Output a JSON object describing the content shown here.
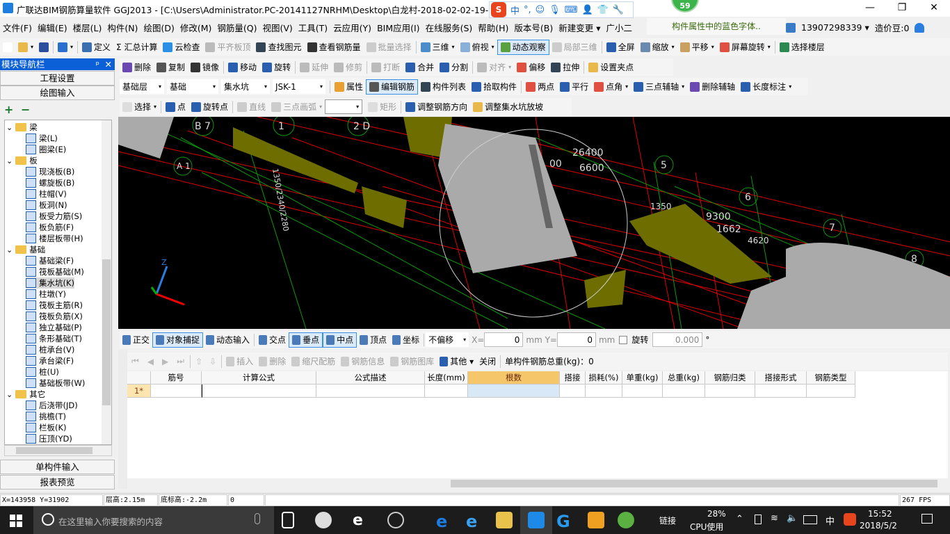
{
  "titlebar": {
    "title": "广联达BIM钢筋算量软件 GGJ2013 - [C:\\Users\\Administrator.PC-20141127NRHM\\Desktop\\白龙村-2018-02-02-19-24-35",
    "minimize": "—",
    "restore": "❐",
    "close": "✕"
  },
  "ime": {
    "logo": "S",
    "items": [
      "中",
      "°,",
      "☺",
      "🎙",
      "⌨",
      "👤",
      "👕",
      "🔧"
    ]
  },
  "badge": "59",
  "menu": [
    "文件(F)",
    "编辑(E)",
    "楼层(L)",
    "构件(N)",
    "绘图(D)",
    "修改(M)",
    "钢筋量(Q)",
    "视图(V)",
    "工具(T)",
    "云应用(Y)",
    "BIM应用(I)",
    "在线服务(S)",
    "帮助(H)",
    "版本号(B)",
    "新建变更 ▾",
    "广小二"
  ],
  "tip": "构件属性中的蓝色字体..",
  "account": {
    "phone": "13907298339 ▾",
    "beans": "造价豆:0"
  },
  "toolbar1": [
    {
      "l": "",
      "c": "#fff",
      "n": "new-file"
    },
    {
      "l": "",
      "c": "#e8b84a",
      "n": "open-folder",
      "dd": 1
    },
    {
      "l": "",
      "c": "#2b4f9e",
      "n": "save"
    },
    {
      "sep": 1
    },
    {
      "l": "",
      "c": "#2a6fd0",
      "n": "undo",
      "dd": 1
    },
    {
      "sep": 1
    },
    {
      "l": "定义",
      "c": "#3a6fb0",
      "n": "define"
    },
    {
      "l": "Σ 汇总计算",
      "n": "summary-calc"
    },
    {
      "l": "云检查",
      "c": "#2b8fe6",
      "n": "cloud-check"
    },
    {
      "l": "平齐板顶",
      "c": "#bbb",
      "n": "align-slab-top",
      "dis": 1
    },
    {
      "l": "查找图元",
      "c": "#345",
      "n": "find-element"
    },
    {
      "l": "查看钢筋量",
      "c": "#333",
      "n": "view-rebar"
    },
    {
      "l": "批量选择",
      "c": "#ccc",
      "n": "batch-select",
      "dis": 1
    },
    {
      "sep": 1
    },
    {
      "l": "三维",
      "c": "#4a8ccc",
      "n": "3d",
      "dd": 1
    },
    {
      "l": "俯视",
      "c": "#8ab0d8",
      "n": "top-view",
      "dd": 1
    },
    {
      "l": "动态观察",
      "c": "#5aa040",
      "n": "orbit",
      "act": 1
    },
    {
      "l": "局部三维",
      "c": "#ccc",
      "n": "local-3d",
      "dis": 1
    },
    {
      "sep": 1
    },
    {
      "l": "全屏",
      "c": "#2a5fb0",
      "n": "fullscreen"
    },
    {
      "l": "缩放",
      "c": "#6a8ab0",
      "n": "zoom",
      "dd": 1
    },
    {
      "l": "平移",
      "c": "#c8a060",
      "n": "pan",
      "dd": 1
    },
    {
      "l": "屏幕旋转",
      "c": "#e05040",
      "n": "screen-rotate",
      "dd": 1
    },
    {
      "sep": 1
    },
    {
      "l": "选择楼层",
      "c": "#2a8a50",
      "n": "select-floor"
    }
  ],
  "toolbar2": [
    {
      "l": "删除",
      "c": "#6a4ab0",
      "n": "delete"
    },
    {
      "l": "复制",
      "c": "#555",
      "n": "copy"
    },
    {
      "l": "镜像",
      "c": "#333",
      "n": "mirror"
    },
    {
      "sep": 1
    },
    {
      "l": "移动",
      "c": "#2a5fb0",
      "n": "move"
    },
    {
      "l": "旋转",
      "c": "#2a5fb0",
      "n": "rotate"
    },
    {
      "sep": 1
    },
    {
      "l": "延伸",
      "c": "#bbb",
      "n": "extend",
      "dis": 1
    },
    {
      "l": "修剪",
      "c": "#bbb",
      "n": "trim",
      "dis": 1
    },
    {
      "sep": 1
    },
    {
      "l": "打断",
      "c": "#bbb",
      "n": "break",
      "dis": 1
    },
    {
      "l": "合并",
      "c": "#2a5fb0",
      "n": "merge"
    },
    {
      "l": "分割",
      "c": "#2a5fb0",
      "n": "split"
    },
    {
      "sep": 1
    },
    {
      "l": "对齐",
      "c": "#bbb",
      "n": "align",
      "dis": 1,
      "dd": 1
    },
    {
      "l": "偏移",
      "c": "#e05040",
      "n": "offset"
    },
    {
      "l": "拉伸",
      "c": "#345",
      "n": "stretch"
    },
    {
      "sep": 1
    },
    {
      "l": "设置夹点",
      "c": "#e8b84a",
      "n": "set-grip"
    }
  ],
  "selectors": [
    "基础层",
    "基础",
    "集水坑",
    "JSK-1"
  ],
  "toolbar3": [
    {
      "l": "属性",
      "c": "#e8a030",
      "n": "properties"
    },
    {
      "l": "编辑钢筋",
      "c": "#555",
      "n": "edit-rebar",
      "act": 1
    },
    {
      "l": "构件列表",
      "c": "#345",
      "n": "component-list"
    },
    {
      "l": "拾取构件",
      "c": "#2a5fb0",
      "n": "pick-component"
    },
    {
      "sep": 1
    },
    {
      "l": "两点",
      "c": "#e05040",
      "n": "two-point"
    },
    {
      "l": "平行",
      "c": "#2a5fb0",
      "n": "parallel"
    },
    {
      "l": "点角",
      "c": "#e05040",
      "n": "point-angle",
      "dd": 1
    },
    {
      "l": "三点辅轴",
      "c": "#2a5fb0",
      "n": "three-point-axis",
      "dd": 1
    },
    {
      "l": "删除辅轴",
      "c": "#6a4ab0",
      "n": "delete-axis"
    },
    {
      "l": "长度标注",
      "c": "#2a5fb0",
      "n": "length-dim",
      "dd": 1
    }
  ],
  "toolbar4": [
    {
      "l": "选择",
      "c": "#ddd",
      "n": "select",
      "dd": 1
    },
    {
      "sep": 1
    },
    {
      "l": "点",
      "c": "#2a5fb0",
      "n": "point"
    },
    {
      "l": "旋转点",
      "c": "#2a5fb0",
      "n": "rotate-point"
    },
    {
      "sep": 1
    },
    {
      "l": "直线",
      "c": "#ccc",
      "n": "line",
      "dis": 1
    },
    {
      "l": "三点画弧",
      "c": "#ccc",
      "n": "three-point-arc",
      "dis": 1,
      "dd": 1
    },
    {
      "combo": 1
    },
    {
      "l": "矩形",
      "c": "#ddd",
      "n": "rectangle",
      "dis": 1
    },
    {
      "sep": 1
    },
    {
      "l": "调整钢筋方向",
      "c": "#2a5fb0",
      "n": "adjust-rebar-dir"
    },
    {
      "l": "调整集水坑放坡",
      "c": "#e8b84a",
      "n": "adjust-pit-slope"
    }
  ],
  "nav": {
    "title": "模块导航栏",
    "pin": "ᵖ",
    "close": "✕",
    "project_settings": "工程设置",
    "draw_input": "绘图输入",
    "single_input": "单构件输入",
    "report": "报表预览",
    "expand": "+",
    "collapse": "−"
  },
  "tree": [
    {
      "f": 1,
      "l": "梁"
    },
    {
      "l": "梁(L)"
    },
    {
      "l": "圈梁(E)"
    },
    {
      "f": 1,
      "l": "板"
    },
    {
      "l": "现浇板(B)"
    },
    {
      "l": "螺旋板(B)"
    },
    {
      "l": "柱帽(V)"
    },
    {
      "l": "板洞(N)"
    },
    {
      "l": "板受力筋(S)"
    },
    {
      "l": "板负筋(F)"
    },
    {
      "l": "楼层板带(H)"
    },
    {
      "f": 1,
      "l": "基础"
    },
    {
      "l": "基础梁(F)"
    },
    {
      "l": "筏板基础(M)"
    },
    {
      "l": "集水坑(K)",
      "sel": 1
    },
    {
      "l": "柱墩(Y)"
    },
    {
      "l": "筏板主筋(R)"
    },
    {
      "l": "筏板负筋(X)"
    },
    {
      "l": "独立基础(P)"
    },
    {
      "l": "条形基础(T)"
    },
    {
      "l": "桩承台(V)"
    },
    {
      "l": "承台梁(F)"
    },
    {
      "l": "桩(U)"
    },
    {
      "l": "基础板带(W)"
    },
    {
      "f": 1,
      "l": "其它"
    },
    {
      "l": "后浇带(JD)"
    },
    {
      "l": "挑檐(T)"
    },
    {
      "l": "栏板(K)"
    },
    {
      "l": "压顶(YD)"
    }
  ],
  "viewport": {
    "labels": [
      "B 7",
      "1",
      "2 D",
      "A 1",
      "26400",
      "6600",
      "5",
      "6",
      "7",
      "8",
      "9300",
      "1662",
      "1350",
      "4620",
      "00",
      "1350/2340/2280"
    ],
    "axis": "Z",
    "bg": "#000000"
  },
  "snapbar": {
    "items": [
      {
        "l": "正交",
        "n": "ortho"
      },
      {
        "l": "对象捕捉",
        "n": "object-snap",
        "act": 1
      },
      {
        "l": "动态输入",
        "n": "dynamic-input"
      },
      {
        "sep": 1
      },
      {
        "l": "交点",
        "n": "intersection"
      },
      {
        "l": "垂点",
        "n": "perpendicular",
        "act": 1
      },
      {
        "l": "中点",
        "n": "midpoint",
        "act": 1
      },
      {
        "l": "顶点",
        "n": "vertex"
      },
      {
        "l": "坐标",
        "n": "coordinate"
      }
    ],
    "offset": "不偏移",
    "x_label": "X=",
    "x": "0",
    "y_label": "mm Y=",
    "y": "0",
    "mm": "mm",
    "rotate_label": "旋转",
    "rotate": "0.000",
    "deg": "°"
  },
  "gridbar": {
    "items": [
      {
        "l": "插入",
        "dis": 1,
        "n": "insert"
      },
      {
        "l": "删除",
        "dis": 1,
        "n": "delete-row"
      },
      {
        "l": "缩尺配筋",
        "dis": 1,
        "n": "scale-rebar"
      },
      {
        "l": "钢筋信息",
        "dis": 1,
        "n": "rebar-info"
      },
      {
        "l": "钢筋图库",
        "dis": 1,
        "n": "rebar-library"
      },
      {
        "l": "其他 ▾",
        "n": "other"
      },
      {
        "l": "关闭",
        "n": "close-grid"
      }
    ],
    "total": "单构件钢筋总重(kg)：0"
  },
  "table": {
    "columns": [
      "",
      "筋号",
      "计算公式",
      "公式描述",
      "长度(mm)",
      "根数",
      "搭接",
      "损耗(%)",
      "单重(kg)",
      "总重(kg)",
      "钢筋归类",
      "搭接形式",
      "钢筋类型"
    ],
    "rows": [
      [
        "1*",
        "",
        "",
        "",
        "",
        "",
        "",
        "",
        "",
        "",
        "",
        "",
        ""
      ]
    ]
  },
  "status": {
    "coords": "X=143958 Y=31902",
    "floor_height": "层高:2.15m",
    "base_height": "底标高:-2.2m",
    "value": "0",
    "fps": "267 FPS"
  },
  "taskbar": {
    "search": "在这里输入你要搜索的内容",
    "link": "链接",
    "cpu": "28%",
    "cpu_label": "CPU使用",
    "ime": "中",
    "time": "15:52",
    "date": "2018/5/2"
  }
}
